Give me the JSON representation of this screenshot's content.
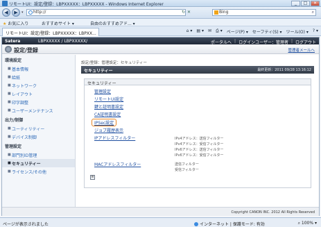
{
  "window": {
    "title": "リモートUI：設定/登録：LBPXXXXX：LBPXXXXX - Windows Internet Explorer",
    "btn_min": "_",
    "btn_max": "□",
    "btn_close": "✕"
  },
  "address": {
    "url": "http://",
    "search": "Bing",
    "back": "◀",
    "forward": "▶",
    "drop": "▾",
    "icons": [
      "↻",
      "✕"
    ],
    "search_icon": "⌕"
  },
  "favorites": {
    "fav_label": "お気に入り",
    "suggested": "おすすめサイト ▾",
    "free_hotmail": "自由のおすすめアド... ▾"
  },
  "tab": {
    "label": "リモートUI：設定/登録：LBPXXXXX：LBPXX..."
  },
  "commandbar": {
    "items": [
      "⌂ ▾",
      "▤ ▾",
      "✉",
      "⎙ ▾",
      "ページ(P) ▾",
      "セーフティ(S) ▾",
      "ツール(O) ▾",
      "? ▾"
    ]
  },
  "app": {
    "brand": "Satera",
    "device": "LBPXXXXX / LBPXXXXX/",
    "links": [
      "ポータルへ",
      "ログインユーザー：管理者",
      "ログアウト"
    ],
    "sep": "|",
    "page_title": "設定/登録",
    "portal_link": "管理者メールへ",
    "breadcrumb": "設定/登録：管理設定：セキュリティー",
    "panel_title": "セキュリティー",
    "updated": "最終更新：2011 09/28 13:16:12",
    "box_title": "セキュリティー",
    "copyright": "Copyright CANON INC. 2012 All Rights Reserved",
    "cmd_icon": "≡"
  },
  "sidebar": {
    "sections": [
      {
        "label": "環境設定",
        "items": [
          "基本情報",
          "給紙",
          "ネットワーク",
          "レイアウト",
          "印字調整",
          "ユーザーメンテナンス"
        ]
      },
      {
        "label": "出力/制御",
        "items": [
          "ユーティリティー",
          "デバイス制御"
        ]
      },
      {
        "label": "管理設定",
        "items": [
          "部門別ID管理",
          "セキュリティー",
          "ライセンス/その他"
        ]
      }
    ],
    "bullet": "■"
  },
  "links": [
    "管理設定",
    "リモートUI設定",
    "鍵と証明書設定",
    "CA証明書設定",
    "IPSec設定",
    "ジョブ履歴表示",
    "IPアドレスフィルター",
    "MACアドレスフィルター"
  ],
  "filters": {
    "ip": [
      "IPv4アドレス：送信フィルター",
      "IPv4アドレス：受信フィルター",
      "IPv6アドレス：送信フィルター",
      "IPv6アドレス：受信フィルター"
    ],
    "mac": [
      "送信フィルター",
      "受信フィルター"
    ]
  },
  "status": {
    "left": "ページが表示されました",
    "zone": "インターネット | 保護モード: 有効",
    "zoom": "⌕ 100% ▾"
  }
}
